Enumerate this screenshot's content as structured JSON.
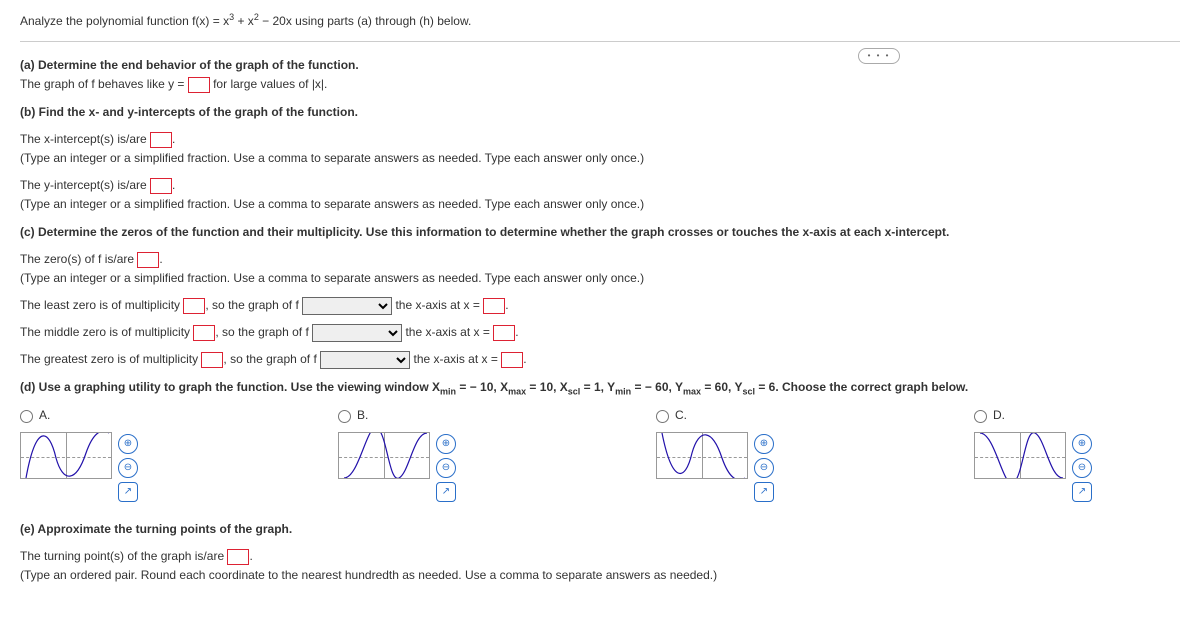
{
  "intro": "Analyze the polynomial function f(x) = x³ + x² − 20x using parts (a) through (h) below.",
  "ellipsis": "• • •",
  "a": {
    "heading": "(a) Determine the end behavior of the graph of the function.",
    "line_pre": "The graph of f behaves like y = ",
    "line_post": " for large values of |x|."
  },
  "b": {
    "heading": "(b) Find the x- and y-intercepts of the graph of the function.",
    "x_pre": "The x-intercept(s) is/are ",
    "x_post": ".",
    "y_pre": "The y-intercept(s) is/are ",
    "y_post": ".",
    "hint": "(Type an integer or a simplified fraction. Use a comma to separate answers as needed. Type each answer only once.)"
  },
  "c": {
    "heading": "(c) Determine the zeros of the function and their multiplicity. Use this information to determine whether the graph crosses or touches the x-axis at each x-intercept.",
    "zeros_pre": "The zero(s) of f is/are ",
    "zeros_post": ".",
    "hint": "(Type an integer or a simplified fraction. Use a comma to separate answers as needed. Type each answer only once.)",
    "least_pre": "The least zero is of multiplicity ",
    "middle_pre": "The middle zero is of multiplicity ",
    "greatest_pre": "The greatest zero is of multiplicity ",
    "so": ", so the graph of f",
    "xaxis": " the x-axis at x = ",
    "period": "."
  },
  "d": {
    "heading_pre": "(d) Use a graphing utility to graph the function. Use the viewing window X",
    "heading_rest": " = − 10, Xmax = 10, Xscl = 1, Ymin = − 60, Ymax = 60, Yscl = 6. Choose the correct graph below.",
    "heading_full": "(d) Use a graphing utility to graph the function. Use the viewing window Xmin = − 10, Xmax = 10, Xscl = 1, Ymin = − 60, Ymax = 60, Yscl = 6. Choose the correct graph below.",
    "options": [
      "A.",
      "B.",
      "C.",
      "D."
    ]
  },
  "e": {
    "heading": "(e) Approximate the turning points of the graph.",
    "line_pre": "The turning point(s) of the graph is/are ",
    "line_post": ".",
    "hint": "(Type an ordered pair. Round each coordinate to the nearest hundredth as needed. Use a comma to separate answers as needed.)"
  },
  "icons": {
    "zoom_in": "⊕",
    "zoom_out": "⊖",
    "popout": "↗"
  }
}
